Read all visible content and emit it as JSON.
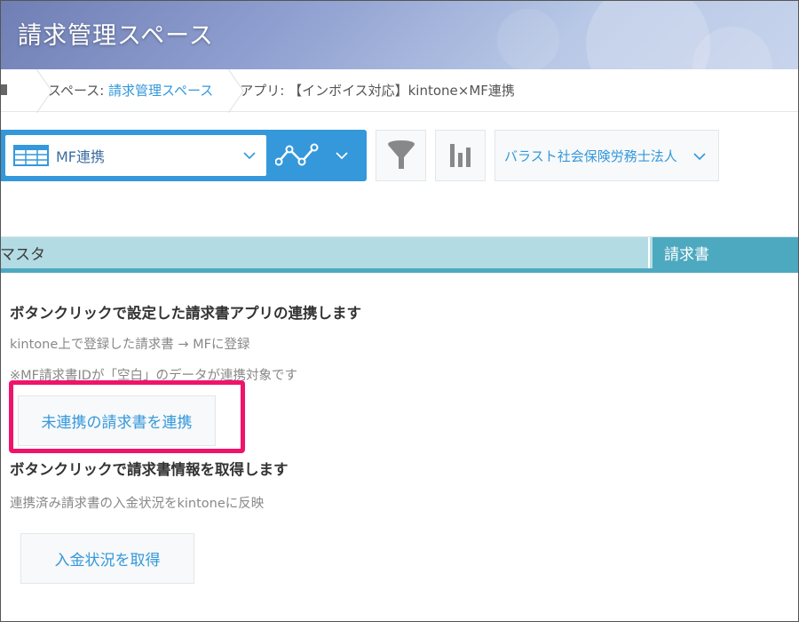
{
  "space": {
    "title": "請求管理スペース"
  },
  "breadcrumb": {
    "space_prefix": "スペース: ",
    "space_name": "請求管理スペース",
    "app_prefix": "アプリ: ",
    "app_name": "【インボイス対応】kintone×MF連携"
  },
  "toolbar": {
    "view_label": "MF連携",
    "view_icon": "table-icon",
    "graph_icon": "graph-icon",
    "filter_icon": "filter-icon",
    "chart_icon": "bar-chart-icon",
    "org_label": "バラスト社会保険労務士法人",
    "accent_color": "#3498db"
  },
  "tabs": {
    "master_label": "マスタ",
    "invoice_label": "請求書"
  },
  "section1": {
    "heading": "ボタンクリックで設定した請求書アプリの連携します",
    "desc1": "kintone上で登録した請求書 → MFに登録",
    "desc2": "※MF請求書IDが「空白」のデータが連携対象です",
    "button_label": "未連携の請求書を連携",
    "highlight_color": "#f0136a"
  },
  "section2": {
    "heading": "ボタンクリックで請求書情報を取得します",
    "desc1": "連携済み請求書の入金状況をkintoneに反映",
    "button_label": "入金状況を取得"
  }
}
